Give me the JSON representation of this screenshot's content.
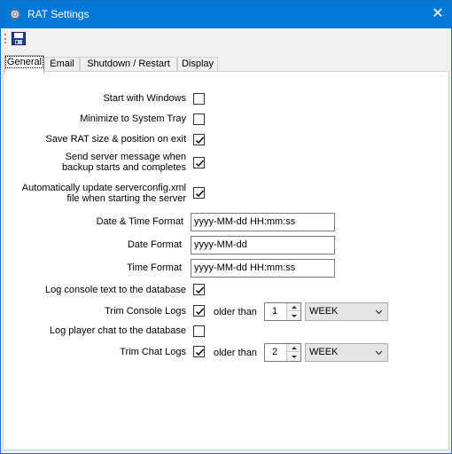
{
  "window": {
    "title": "RAT Settings",
    "close_symbol": "✕"
  },
  "tabs": [
    {
      "label": "General",
      "active": true
    },
    {
      "label": "Email",
      "active": false
    },
    {
      "label": "Shutdown / Restart",
      "active": false
    },
    {
      "label": "Display",
      "active": false
    }
  ],
  "general": {
    "start_with_windows": {
      "label": "Start with Windows",
      "checked": false
    },
    "minimize_to_tray": {
      "label": "Minimize to System Tray",
      "checked": false
    },
    "save_size_position": {
      "label": "Save RAT size & position on exit",
      "checked": true
    },
    "send_server_message": {
      "label_line1": "Send server message when",
      "label_line2": "backup starts and completes",
      "checked": true
    },
    "auto_update_config": {
      "label_line1": "Automatically update serverconfig.xml",
      "label_line2": "file when starting the server",
      "checked": true
    },
    "date_time_format": {
      "label": "Date & Time Format",
      "value": "yyyy-MM-dd HH:mm:ss"
    },
    "date_format": {
      "label": "Date Format",
      "value": "yyyy-MM-dd"
    },
    "time_format": {
      "label": "Time Format",
      "value": "yyyy-MM-dd HH:mm:ss"
    },
    "log_console": {
      "label": "Log console text to the database",
      "checked": true
    },
    "trim_console_logs": {
      "label": "Trim Console Logs",
      "checked": true,
      "older_than_label": "older than",
      "amount": "1",
      "unit": "WEEK"
    },
    "log_player_chat": {
      "label": "Log player chat to the database",
      "checked": false
    },
    "trim_chat_logs": {
      "label": "Trim Chat Logs",
      "checked": true,
      "older_than_label": "older than",
      "amount": "2",
      "unit": "WEEK"
    }
  },
  "colors": {
    "titlebar": "#0078d7",
    "window_bg": "#f0f0f0",
    "panel_bg": "#ffffff"
  }
}
